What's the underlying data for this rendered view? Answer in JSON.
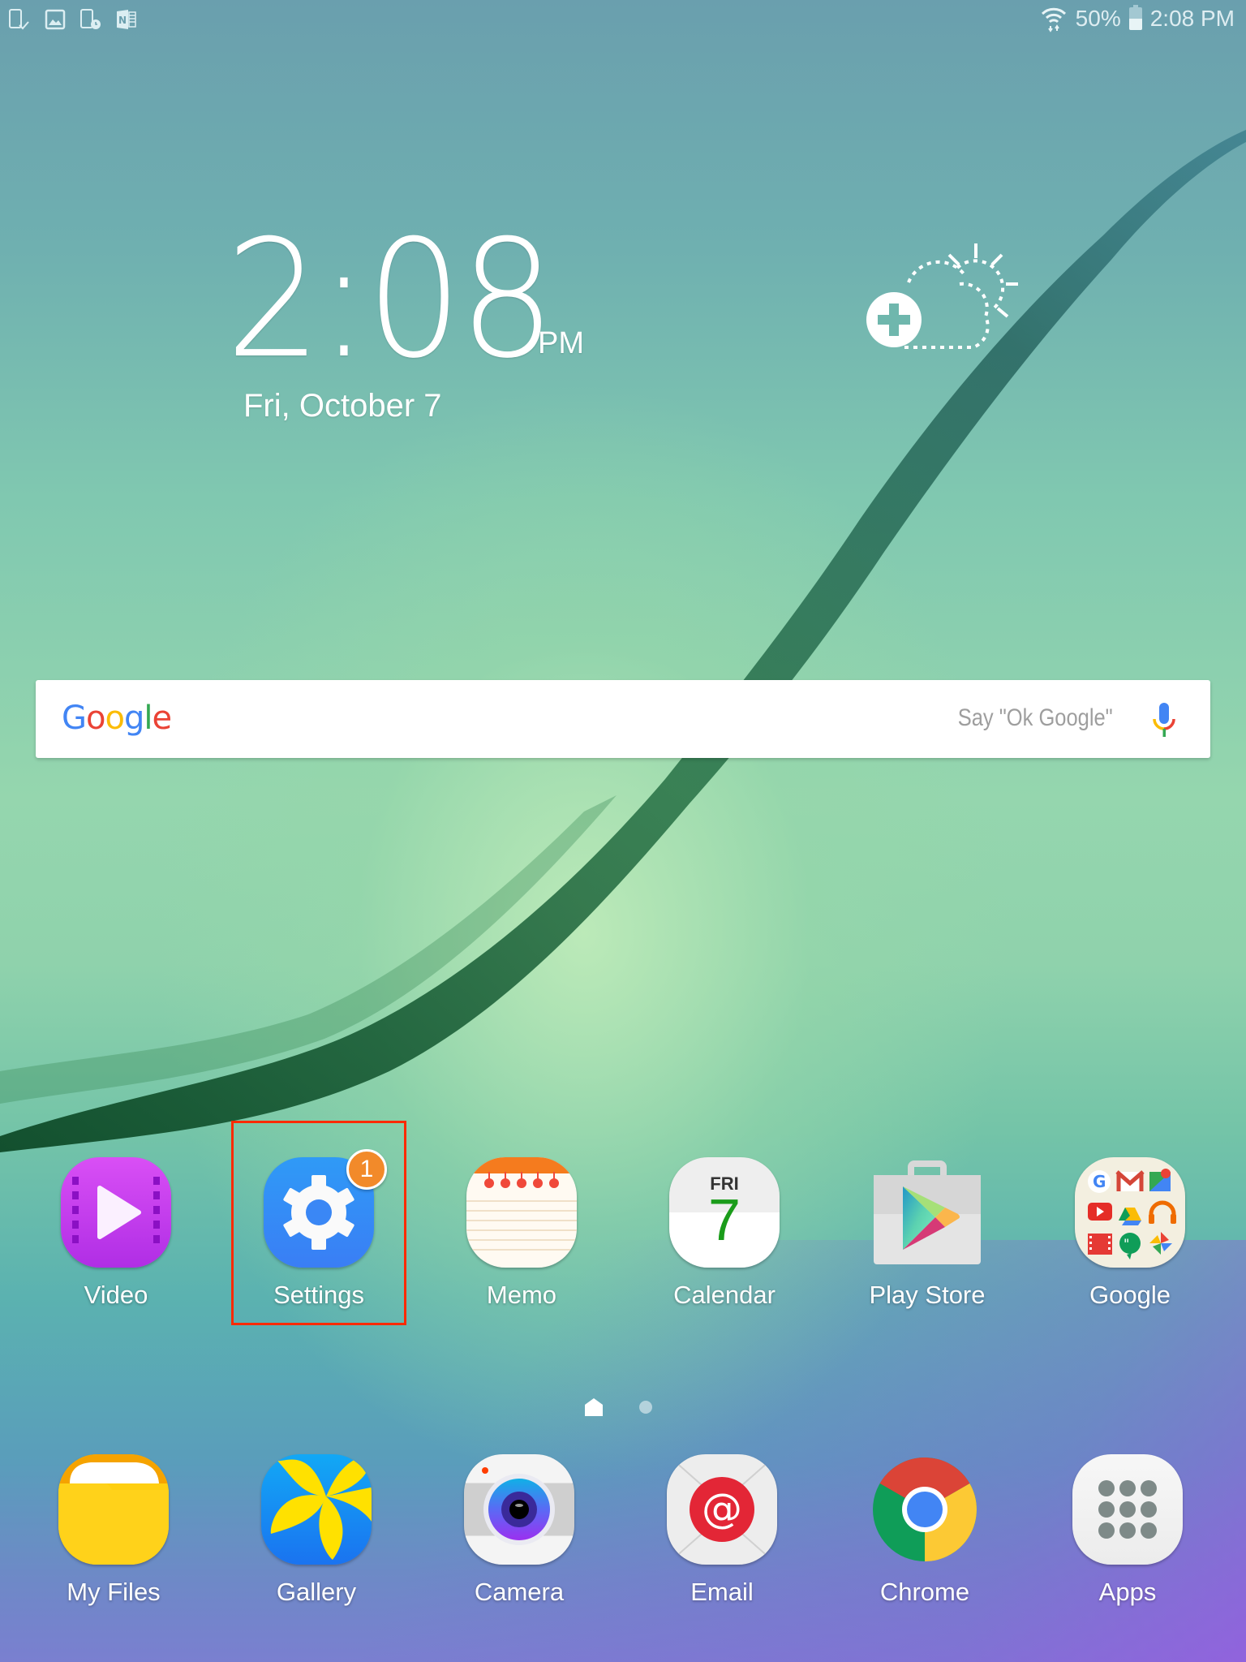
{
  "status_bar": {
    "notification_icons": [
      "device-check-icon",
      "gallery-image-icon",
      "device-clock-icon",
      "onenote-icon"
    ],
    "wifi": "wifi-icon",
    "battery_percent": "50%",
    "battery_level": 0.5,
    "time": "2:08 PM"
  },
  "clock_widget": {
    "time": "2:08",
    "ampm": "PM",
    "date": "Fri, October 7"
  },
  "weather_widget": {
    "icon": "add-weather-icon"
  },
  "search_bar": {
    "logo": [
      "G",
      "o",
      "o",
      "g",
      "l",
      "e"
    ],
    "hint": "Say \"Ok Google\"",
    "mic_icon": "microphone-icon"
  },
  "home_apps": [
    {
      "label": "Video",
      "icon": "video-icon"
    },
    {
      "label": "Settings",
      "icon": "settings-gear-icon",
      "badge": "1",
      "highlighted": true
    },
    {
      "label": "Memo",
      "icon": "memo-icon"
    },
    {
      "label": "Calendar",
      "icon": "calendar-icon",
      "day": "FRI",
      "date": "7"
    },
    {
      "label": "Play Store",
      "icon": "play-store-icon"
    },
    {
      "label": "Google",
      "icon": "google-folder-icon"
    }
  ],
  "pager": {
    "pages": 2,
    "current": "home"
  },
  "dock_apps": [
    {
      "label": "My Files",
      "icon": "folder-icon"
    },
    {
      "label": "Gallery",
      "icon": "gallery-flower-icon"
    },
    {
      "label": "Camera",
      "icon": "camera-icon"
    },
    {
      "label": "Email",
      "icon": "email-at-icon"
    },
    {
      "label": "Chrome",
      "icon": "chrome-icon"
    },
    {
      "label": "Apps",
      "icon": "app-drawer-icon"
    }
  ],
  "colors": {
    "highlight_box": "#ff2a00",
    "badge": "#f28a2a",
    "calendar_date": "#1a9c1a"
  }
}
